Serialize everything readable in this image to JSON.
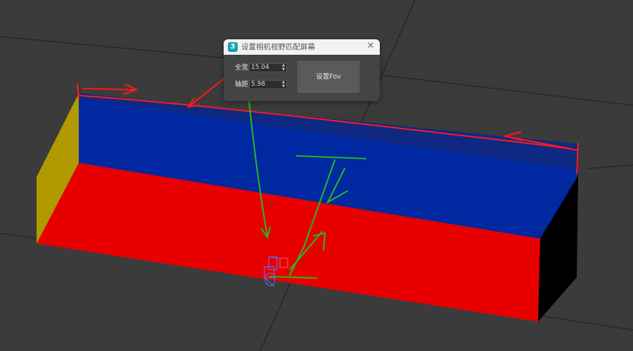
{
  "dialog": {
    "title": "设置相机视野匹配屏幕",
    "app_icon_glyph": "3",
    "fields": [
      {
        "label": "全宽",
        "value": "15.04"
      },
      {
        "label": "轴距",
        "value": "5.98"
      }
    ],
    "button_label": "设置Fov",
    "close_glyph": "✕"
  },
  "viewport": {
    "background_color": "#3b3b3b",
    "colors": {
      "top_face": "#0028a0",
      "floor_face": "#e80000",
      "left_face": "#b09a00",
      "right_face": "#000000",
      "annotation_red": "#ff1a1a",
      "annotation_green": "#22bb22",
      "camera_gizmo": "#5577ff"
    },
    "icons": [
      "camera-gizmo-icon"
    ]
  }
}
